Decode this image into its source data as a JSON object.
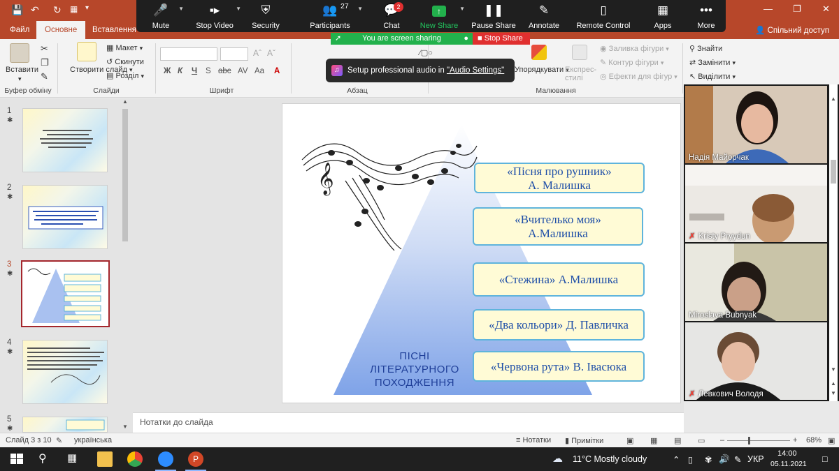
{
  "window": {
    "title": ""
  },
  "tabs": [
    {
      "label": "Файл"
    },
    {
      "label": "Основне"
    },
    {
      "label": "Вставлення"
    }
  ],
  "share_label": "Спільний доступ",
  "ribbon": {
    "paste_label": "Вставити",
    "clipboard_group": "Буфер обміну",
    "new_slide_label": "Створити слайд",
    "layout_label": "Макет",
    "reset_label": "Скинути",
    "section_label": "Розділ",
    "slides_group": "Слайди",
    "font_group": "Шрифт",
    "paragraph_group": "Абзац",
    "arrange_label": "Упорядкувати",
    "express_styles_label": "Експрес-стилі",
    "fill_label": "Заливка фігури",
    "outline_label": "Контур фігури",
    "effects_label": "Ефекти для фігур",
    "drawing_group": "Малювання",
    "find_label": "Знайти",
    "replace_label": "Замінити",
    "select_label": "Виділити"
  },
  "zoom_toolbar": {
    "buttons": [
      {
        "label": "Mute",
        "icon": "microphone-icon"
      },
      {
        "label": "Stop Video",
        "icon": "video-camera-icon"
      },
      {
        "label": "Security",
        "icon": "shield-icon"
      },
      {
        "label": "Participants",
        "icon": "participants-icon",
        "count": "27"
      },
      {
        "label": "Chat",
        "icon": "chat-icon",
        "badge": "2"
      },
      {
        "label": "New Share",
        "icon": "share-up-arrow-icon"
      },
      {
        "label": "Pause Share",
        "icon": "pause-icon"
      },
      {
        "label": "Annotate",
        "icon": "pen-icon"
      },
      {
        "label": "Remote Control",
        "icon": "mouse-icon"
      },
      {
        "label": "Apps",
        "icon": "apps-icon"
      },
      {
        "label": "More",
        "icon": "more-dots-icon"
      }
    ],
    "sharing_text": "You are screen sharing",
    "stop_share": "Stop Share",
    "audio_tip_prefix": "Setup professional audio in ",
    "audio_tip_link": "\"Audio Settings\""
  },
  "thumbnails": [
    {
      "num": "1"
    },
    {
      "num": "2"
    },
    {
      "num": "3"
    },
    {
      "num": "4"
    },
    {
      "num": "5"
    }
  ],
  "slide": {
    "songs": [
      {
        "line1": "«Пісня про рушник»",
        "line2": "А. Малишка"
      },
      {
        "line1": "«Вчителько моя»",
        "line2": "А.Малишка"
      },
      {
        "line1": "«Стежина» А.Малишка",
        "line2": ""
      },
      {
        "line1": "«Два кольори» Д. Павличка",
        "line2": ""
      },
      {
        "line1": "«Червона рута» В. Івасюка",
        "line2": ""
      }
    ],
    "pyramid_label_1": "ПІСНІ",
    "pyramid_label_2": "ЛІТЕРАТУРНОГО",
    "pyramid_label_3": "ПОХОДЖЕННЯ"
  },
  "notes_placeholder": "Нотатки до слайда",
  "participants_video": [
    {
      "name": "Надія Майорчак",
      "muted": false
    },
    {
      "name": "Kristy Pryydun",
      "muted": true
    },
    {
      "name": "Miroslava  Bubnyak",
      "muted": false
    },
    {
      "name": "Левкович Володя",
      "muted": true
    }
  ],
  "status": {
    "slide_of": "Слайд 3 з 10",
    "language": "українська",
    "notes": "Нотатки",
    "comments": "Примітки",
    "zoom": "68%"
  },
  "taskbar": {
    "weather": "11°C  Mostly cloudy",
    "lang": "УКР",
    "time": "14:00",
    "date": "05.11.2021"
  },
  "colors": {
    "accent": "#b7472a",
    "zoom_green": "#22b14c",
    "zoom_red": "#e02f2f",
    "slide_text": "#1f4fa8",
    "box_fill": "#fffbd6",
    "box_border": "#5fb4dc"
  }
}
